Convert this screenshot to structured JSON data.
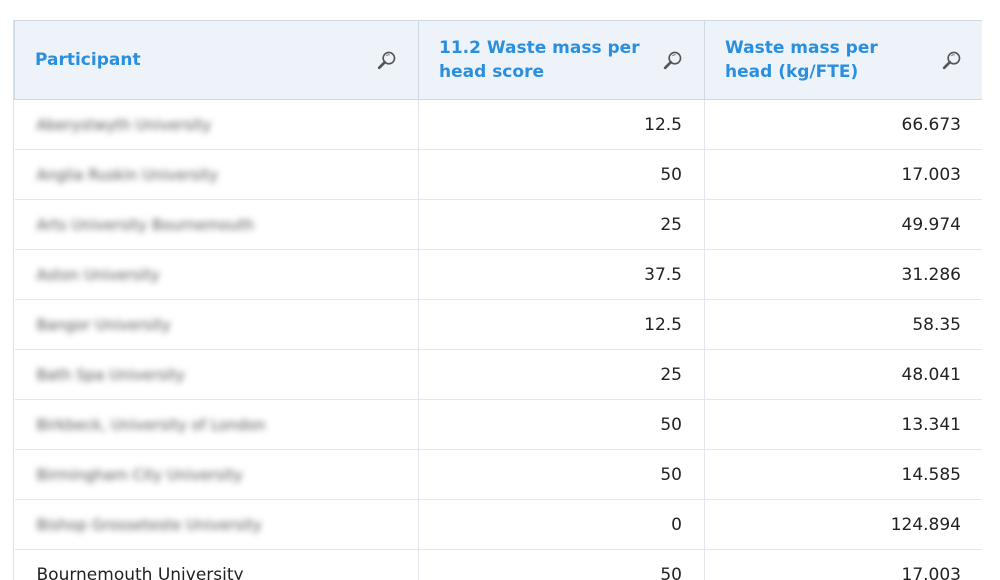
{
  "table": {
    "headers": [
      "Participant",
      "11.2 Waste mass per head score",
      "Waste mass per head (kg/FTE)"
    ],
    "rows": [
      {
        "participant": "Aberystwyth University",
        "score": "12.5",
        "mass": "66.673"
      },
      {
        "participant": "Anglia Ruskin University",
        "score": "50",
        "mass": "17.003"
      },
      {
        "participant": "Arts University Bournemouth",
        "score": "25",
        "mass": "49.974"
      },
      {
        "participant": "Aston University",
        "score": "37.5",
        "mass": "31.286"
      },
      {
        "participant": "Bangor University",
        "score": "12.5",
        "mass": "58.35"
      },
      {
        "participant": "Bath Spa University",
        "score": "25",
        "mass": "48.041"
      },
      {
        "participant": "Birkbeck, University of London",
        "score": "50",
        "mass": "13.341"
      },
      {
        "participant": "Birmingham City University",
        "score": "50",
        "mass": "14.585"
      },
      {
        "participant": "Bishop Grosseteste University",
        "score": "0",
        "mass": "124.894"
      },
      {
        "participant": "Bournemouth University",
        "score": "50",
        "mass": "17.003"
      }
    ]
  },
  "colors": {
    "header_text": "#2b8fe0",
    "header_bg": "#eef3f9",
    "border": "#cfd9e4"
  },
  "icons": {
    "column_search": "search-icon"
  }
}
